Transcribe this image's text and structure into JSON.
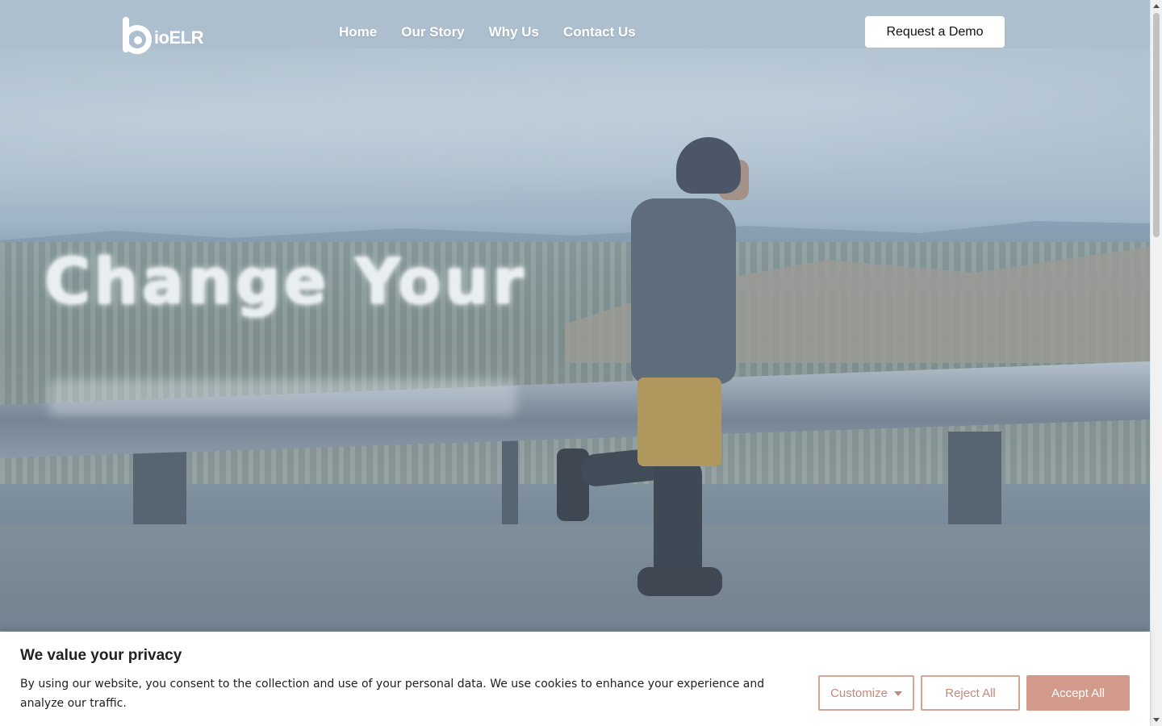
{
  "brand": {
    "logo_text": "ioELR"
  },
  "nav": {
    "items": [
      {
        "label": "Home"
      },
      {
        "label": "Our Story"
      },
      {
        "label": "Why Us"
      },
      {
        "label": "Contact Us"
      }
    ],
    "cta_label": "Request a Demo"
  },
  "hero": {
    "headline": "Change Your"
  },
  "cookie_banner": {
    "title": "We value your privacy",
    "body": "By using our website, you consent to the collection and use of your personal data. We use cookies to enhance your experience and analyze our traffic.",
    "customize_label": "Customize",
    "reject_label": "Reject All",
    "accept_label": "Accept All"
  },
  "colors": {
    "cookie_accent": "#d19a8a",
    "cookie_outline": "#d4a496"
  },
  "icons": {
    "customize_caret": "caret-down-icon"
  }
}
